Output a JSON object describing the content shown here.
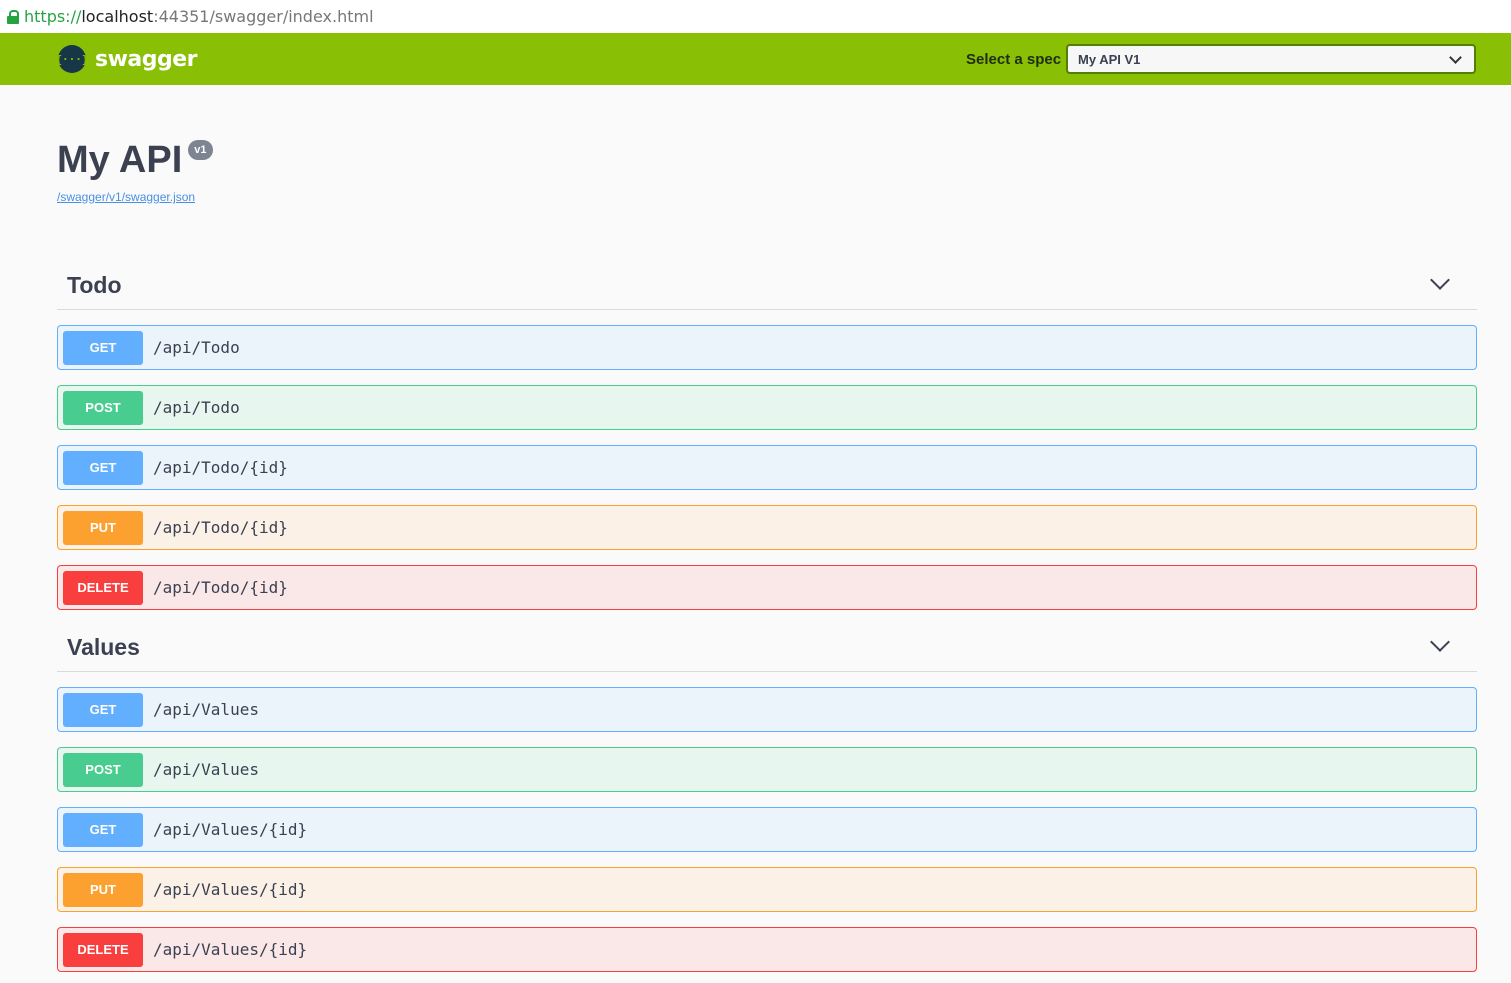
{
  "browser": {
    "url_scheme": "https://",
    "url_host": "localhost",
    "url_rest": ":44351/swagger/index.html"
  },
  "topbar": {
    "logo_glyph": "{···}",
    "logo_text": "swagger",
    "spec_label": "Select a spec",
    "spec_selected": "My API V1"
  },
  "info": {
    "title": "My API",
    "version": "v1",
    "spec_url": "/swagger/v1/swagger.json"
  },
  "colors": {
    "topbar": "#89bf04",
    "get": "#61affe",
    "post": "#49cc90",
    "put": "#fca130",
    "delete": "#f93e3e"
  },
  "sections": [
    {
      "name": "Todo",
      "operations": [
        {
          "method": "GET",
          "path": "/api/Todo"
        },
        {
          "method": "POST",
          "path": "/api/Todo"
        },
        {
          "method": "GET",
          "path": "/api/Todo/{id}"
        },
        {
          "method": "PUT",
          "path": "/api/Todo/{id}"
        },
        {
          "method": "DELETE",
          "path": "/api/Todo/{id}"
        }
      ]
    },
    {
      "name": "Values",
      "operations": [
        {
          "method": "GET",
          "path": "/api/Values"
        },
        {
          "method": "POST",
          "path": "/api/Values"
        },
        {
          "method": "GET",
          "path": "/api/Values/{id}"
        },
        {
          "method": "PUT",
          "path": "/api/Values/{id}"
        },
        {
          "method": "DELETE",
          "path": "/api/Values/{id}"
        }
      ]
    }
  ]
}
